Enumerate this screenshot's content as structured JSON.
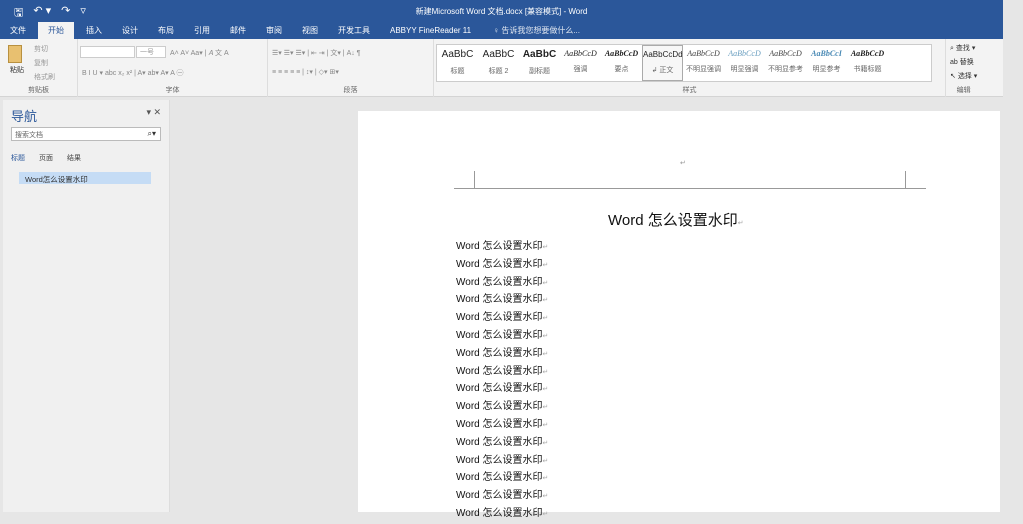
{
  "window": {
    "title": "新建Microsoft Word 文档.docx [兼容模式] - Word"
  },
  "qat": {
    "save": "🖫",
    "undo": "↶ ▾",
    "redo": "↷",
    "more": "▿"
  },
  "tabs": [
    "文件",
    "开始",
    "插入",
    "设计",
    "布局",
    "引用",
    "邮件",
    "审阅",
    "视图",
    "开发工具",
    "ABBYY FineReader 11"
  ],
  "tell_me": "告诉我您想要做什么...",
  "ribbon": {
    "clipboard": {
      "paste": "粘贴",
      "cut": "剪切",
      "copy": "复制",
      "format_painter": "格式刷",
      "label": "剪贴板"
    },
    "font": {
      "size": "一号",
      "row1": "A˄ A˅ Aa▾ | 𝐴 文 A",
      "row2": "B I U ▾ abc x₂ x² | A▾ ab▾ A▾ A ㊀",
      "label": "字体"
    },
    "paragraph": {
      "row1": "☰▾ ☰▾ ☰▾ | ⇤ ⇥ | 文▾ | A↓ ¶",
      "row2": "≡ ≡ ≡ ≡ ≡ | ↕▾ | ◇▾ ⊞▾",
      "label": "段落"
    },
    "styles": {
      "items": [
        {
          "sample": "AaBbC",
          "name": "标题"
        },
        {
          "sample": "AaBbC",
          "name": "标题 2"
        },
        {
          "sample": "AaBbC",
          "name": "副标题"
        },
        {
          "sample": "AaBbCcD",
          "name": "强调"
        },
        {
          "sample": "AaBbCcD",
          "name": "要点"
        },
        {
          "sample": "AaBbCcDd",
          "name": "↲ 正文"
        },
        {
          "sample": "AaBbCcD",
          "name": "不明显强调"
        },
        {
          "sample": "AaBbCcD",
          "name": "明显强调"
        },
        {
          "sample": "AaBbCcD",
          "name": "不明显参考"
        },
        {
          "sample": "AaBbCcI",
          "name": "明显参考"
        },
        {
          "sample": "AaBbCcD",
          "name": "书籍标题"
        }
      ],
      "label": "样式"
    },
    "editing": {
      "find": "查找 ▾",
      "replace": "替换",
      "select": "选择 ▾",
      "label": "编辑"
    }
  },
  "nav": {
    "title": "导航",
    "controls": "▾ ✕",
    "search_placeholder": "搜索文档",
    "tabs": [
      "标题",
      "页面",
      "结果"
    ],
    "heading": "Word怎么设置水印"
  },
  "document": {
    "header_mark": "↵",
    "title": "Word 怎么设置水印",
    "lines": [
      "Word 怎么设置水印",
      "Word 怎么设置水印",
      "Word 怎么设置水印",
      "Word 怎么设置水印",
      "Word 怎么设置水印",
      "Word 怎么设置水印",
      "Word 怎么设置水印",
      "Word 怎么设置水印",
      "Word 怎么设置水印",
      "Word 怎么设置水印",
      "Word 怎么设置水印",
      "Word 怎么设置水印",
      "Word 怎么设置水印",
      "Word 怎么设置水印",
      "Word 怎么设置水印",
      "Word 怎么设置水印"
    ]
  }
}
